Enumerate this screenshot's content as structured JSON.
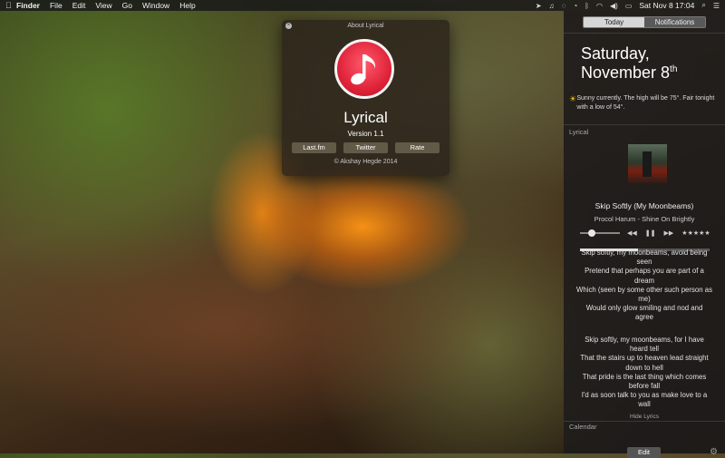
{
  "menubar": {
    "app_name": "Finder",
    "menus": [
      "File",
      "Edit",
      "View",
      "Go",
      "Window",
      "Help"
    ],
    "clock": "Sat Nov 8  17:04"
  },
  "about_window": {
    "title": "About Lyrical",
    "app_name": "Lyrical",
    "version": "Version 1.1",
    "buttons": [
      "Last.fm",
      "Twitter",
      "Rate"
    ],
    "copyright": "© Akshay Hegde 2014",
    "icon_color": "#e0243a"
  },
  "notification_center": {
    "tabs": [
      "Today",
      "Notifications"
    ],
    "date_line1": "Saturday,",
    "date_line2_prefix": "November 8",
    "date_line2_suffix": "th",
    "weather": "Sunny currently. The high will be 75°. Fair tonight with a low of 54°.",
    "lyrical_section": "Lyrical",
    "track": "Skip Softly (My Moonbeams)",
    "artist": "Procol Harum - Shine On Brightly",
    "rating": "★★★★★",
    "playback_progress": 0.45,
    "volume_level": 0.3,
    "lyrics_verse1": "Skip softly, my moonbeams, avoid being seen\nPretend that perhaps you are part of a dream\nWhich (seen by some other such person as me)\nWould only glow smiling and nod and agree",
    "lyrics_verse2": "Skip softly, my moonbeams, for I have heard tell\nThat the stairs up to heaven lead straight down to hell\nThat pride is the last thing which comes before fall\nI'd as soon talk to you as make love to a wall",
    "hide_lyrics": "Hide Lyrics",
    "calendar_section": "Calendar",
    "edit_label": "Edit"
  }
}
